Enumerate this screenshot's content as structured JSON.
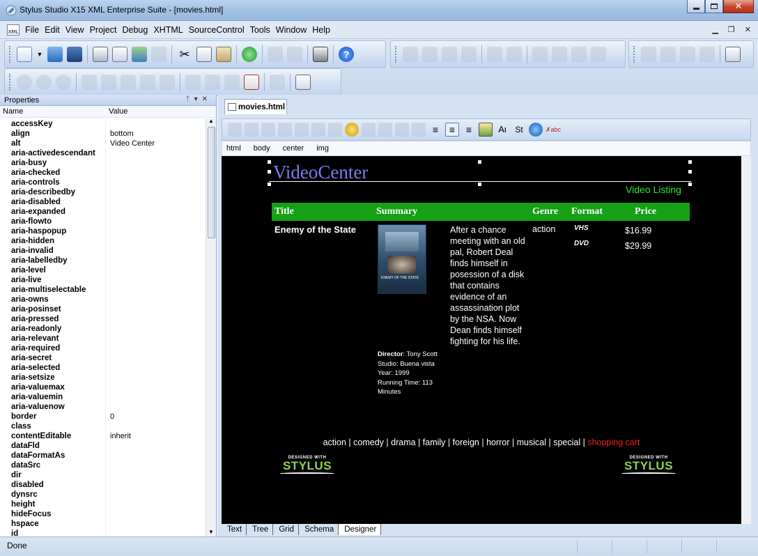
{
  "window": {
    "title": "Stylus Studio X15 XML Enterprise Suite - [movies.html]"
  },
  "menu": [
    "File",
    "Edit",
    "View",
    "Project",
    "Debug",
    "XHTML",
    "SourceControl",
    "Tools",
    "Window",
    "Help"
  ],
  "properties": {
    "panel_title": "Properties",
    "col_name": "Name",
    "col_value": "Value",
    "rows": [
      {
        "name": "accessKey",
        "value": ""
      },
      {
        "name": "align",
        "value": "bottom"
      },
      {
        "name": "alt",
        "value": "Video Center"
      },
      {
        "name": "aria-activedescendant",
        "value": ""
      },
      {
        "name": "aria-busy",
        "value": ""
      },
      {
        "name": "aria-checked",
        "value": ""
      },
      {
        "name": "aria-controls",
        "value": ""
      },
      {
        "name": "aria-describedby",
        "value": ""
      },
      {
        "name": "aria-disabled",
        "value": ""
      },
      {
        "name": "aria-expanded",
        "value": ""
      },
      {
        "name": "aria-flowto",
        "value": ""
      },
      {
        "name": "aria-haspopup",
        "value": ""
      },
      {
        "name": "aria-hidden",
        "value": ""
      },
      {
        "name": "aria-invalid",
        "value": ""
      },
      {
        "name": "aria-labelledby",
        "value": ""
      },
      {
        "name": "aria-level",
        "value": ""
      },
      {
        "name": "aria-live",
        "value": ""
      },
      {
        "name": "aria-multiselectable",
        "value": ""
      },
      {
        "name": "aria-owns",
        "value": ""
      },
      {
        "name": "aria-posinset",
        "value": ""
      },
      {
        "name": "aria-pressed",
        "value": ""
      },
      {
        "name": "aria-readonly",
        "value": ""
      },
      {
        "name": "aria-relevant",
        "value": ""
      },
      {
        "name": "aria-required",
        "value": ""
      },
      {
        "name": "aria-secret",
        "value": ""
      },
      {
        "name": "aria-selected",
        "value": ""
      },
      {
        "name": "aria-setsize",
        "value": ""
      },
      {
        "name": "aria-valuemax",
        "value": ""
      },
      {
        "name": "aria-valuemin",
        "value": ""
      },
      {
        "name": "aria-valuenow",
        "value": ""
      },
      {
        "name": "border",
        "value": "0"
      },
      {
        "name": "class",
        "value": ""
      },
      {
        "name": "contentEditable",
        "value": "inherit"
      },
      {
        "name": "dataFld",
        "value": ""
      },
      {
        "name": "dataFormatAs",
        "value": ""
      },
      {
        "name": "dataSrc",
        "value": ""
      },
      {
        "name": "dir",
        "value": ""
      },
      {
        "name": "disabled",
        "value": ""
      },
      {
        "name": "dynsrc",
        "value": ""
      },
      {
        "name": "height",
        "value": ""
      },
      {
        "name": "hideFocus",
        "value": ""
      },
      {
        "name": "hspace",
        "value": ""
      },
      {
        "name": "id",
        "value": ""
      }
    ]
  },
  "editor": {
    "tab_label": "movies.html",
    "breadcrumb": [
      "html",
      "body",
      "center",
      "img"
    ],
    "bottom_tabs": [
      "Text",
      "Tree",
      "Grid",
      "Schema",
      "Designer"
    ],
    "active_bottom_tab": "Designer"
  },
  "page": {
    "brand": "VideoCenter",
    "listing": "Video Listing",
    "headers": {
      "title": "Title",
      "summary": "Summary",
      "genre": "Genre",
      "format": "Format",
      "price": "Price"
    },
    "movie": {
      "title": "Enemy of the State",
      "poster_caption": "ENEMY OF THE STATE",
      "summary": "After a chance meeting with an old pal, Robert Deal finds himself in posession of a disk that contains evidence of an assassination plot by the NSA. Now Dean finds himself fighting for his life.",
      "genre": "action",
      "formats": [
        {
          "name": "VHS",
          "price": "$16.99"
        },
        {
          "name": "DVD",
          "price": "$29.99"
        }
      ],
      "director_label": "Director",
      "director": ": Tony Scott",
      "studio": "Studio: Buena vista",
      "year": "Year: 1999",
      "running_time": "Running Time: 113 Minutes"
    },
    "genres": [
      "action",
      "comedy",
      "drama",
      "family",
      "foreign",
      "horror",
      "musical",
      "special"
    ],
    "cart_link": "shopping cart",
    "badge_small": "DESIGNED WITH",
    "badge_big": "STYLUS"
  },
  "status": {
    "text": "Done"
  },
  "colors": {
    "header_green": "#15a015",
    "listing_green": "#29e629",
    "brand_blue": "#7b7bf0",
    "cart_red": "#e52222"
  }
}
